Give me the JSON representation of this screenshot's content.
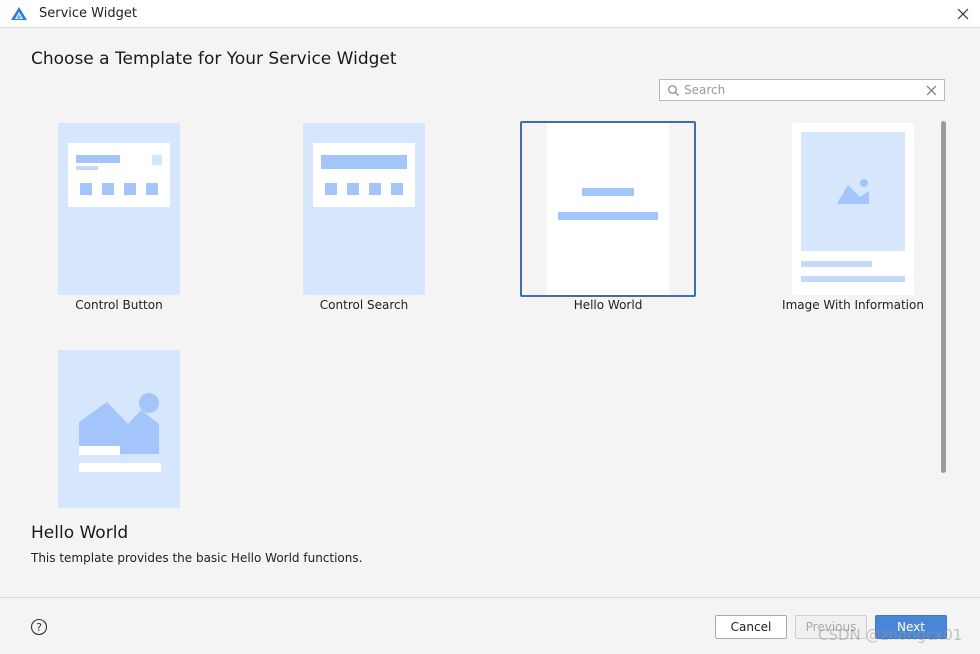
{
  "window": {
    "title": "Service Widget"
  },
  "page": {
    "heading": "Choose a Template for Your Service Widget"
  },
  "search": {
    "placeholder": "Search",
    "value": ""
  },
  "templates": [
    {
      "label": "Control Button"
    },
    {
      "label": "Control Search"
    },
    {
      "label": "Hello World",
      "selected": true
    },
    {
      "label": "Image With Information"
    }
  ],
  "description": {
    "title": "Hello World",
    "text": "This template provides the basic Hello World functions."
  },
  "footer": {
    "help_icon": "question-circle-icon",
    "cancel_label": "Cancel",
    "previous_label": "Previous",
    "next_label": "Next"
  },
  "watermark": "CSDN @zhongcx01",
  "colors": {
    "accent": "#4a86d8",
    "selection_border": "#3e6ea6",
    "thumbnail_bg": "#d6e6fd",
    "thumbnail_shape": "#a3c5fb"
  }
}
